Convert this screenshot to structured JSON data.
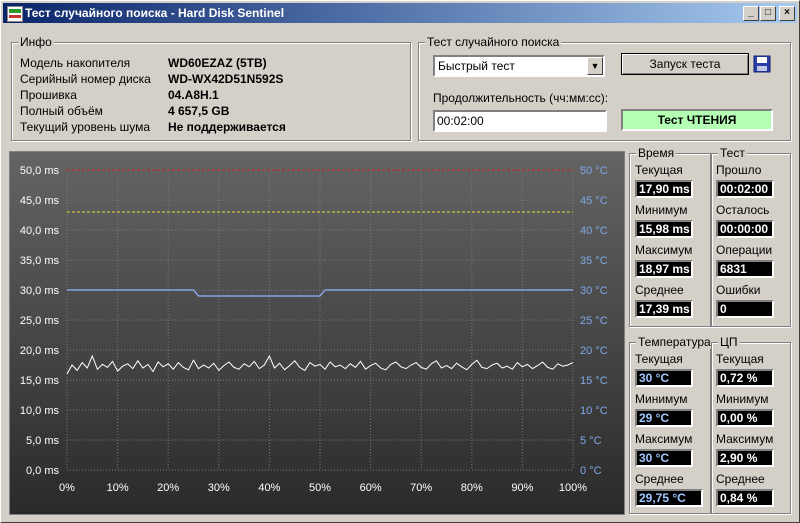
{
  "window": {
    "title": "Тест случайного поиска - Hard Disk Sentinel",
    "min": "_",
    "max": "□",
    "close": "×"
  },
  "info": {
    "title": "Инфо",
    "rows": [
      {
        "label": "Модель накопителя",
        "value": "WD60EZAZ (5TB)"
      },
      {
        "label": "Серийный номер диска",
        "value": "WD-WX42D51N592S"
      },
      {
        "label": "Прошивка",
        "value": "04.A8H.1"
      },
      {
        "label": "Полный объём",
        "value": "4 657,5 GB"
      },
      {
        "label": "Текущий уровень шума",
        "value": "Не поддерживается"
      }
    ]
  },
  "test": {
    "title": "Тест случайного поиска",
    "mode_selected": "Быстрый тест",
    "start_label": "Запуск теста",
    "duration_label": "Продолжительность (чч:мм:сс):",
    "duration_value": "00:02:00",
    "status": "Тест ЧТЕНИЯ"
  },
  "stats": {
    "time_title": "Время",
    "test_title": "Тест",
    "time": [
      {
        "label": "Текущая",
        "value": "17,90 ms"
      },
      {
        "label": "Минимум",
        "value": "15,98 ms"
      },
      {
        "label": "Максимум",
        "value": "18,97 ms"
      },
      {
        "label": "Среднее",
        "value": "17,39 ms"
      }
    ],
    "test": [
      {
        "label": "Прошло",
        "value": "00:02:00"
      },
      {
        "label": "Осталось",
        "value": "00:00:00"
      },
      {
        "label": "Операции",
        "value": "6831"
      },
      {
        "label": "Ошибки",
        "value": "0"
      }
    ],
    "temp_title": "Температура",
    "cpu_title": "ЦП",
    "temp": [
      {
        "label": "Текущая",
        "value": "30 °C"
      },
      {
        "label": "Минимум",
        "value": "29 °C"
      },
      {
        "label": "Максимум",
        "value": "30 °C"
      },
      {
        "label": "Среднее",
        "value": "29,75 °C"
      }
    ],
    "cpu": [
      {
        "label": "Текущая",
        "value": "0,72 %"
      },
      {
        "label": "Минимум",
        "value": "0,00 %"
      },
      {
        "label": "Максимум",
        "value": "2,90 %"
      },
      {
        "label": "Среднее",
        "value": "0,84 %"
      }
    ]
  },
  "chart_data": {
    "type": "line",
    "left_ticks": [
      "50,0 ms",
      "45,0 ms",
      "40,0 ms",
      "35,0 ms",
      "30,0 ms",
      "25,0 ms",
      "20,0 ms",
      "15,0 ms",
      "10,0 ms",
      "5,0 ms",
      "0,0 ms"
    ],
    "right_ticks": [
      "50 °C",
      "45 °C",
      "40 °C",
      "35 °C",
      "30 °C",
      "25 °C",
      "20 °C",
      "15 °C",
      "10 °C",
      "5 °C",
      "0 °C"
    ],
    "x_ticks": [
      "0%",
      "10%",
      "20%",
      "30%",
      "40%",
      "50%",
      "60%",
      "70%",
      "80%",
      "90%",
      "100%"
    ],
    "ylim": [
      0,
      50
    ],
    "xlim": [
      0,
      100
    ],
    "grid": true,
    "colors": {
      "seek": "#ffffff",
      "temperature": "#8fb4ff",
      "max_line": "#d02020",
      "avg_line": "#e0e040",
      "right_axis": "#7fa8e8",
      "left_axis": "#ffffff"
    },
    "reference_lines": [
      {
        "y": 50,
        "color": "#d02020"
      },
      {
        "y": 43,
        "color": "#e0e040"
      }
    ],
    "series": [
      {
        "x": [
          0,
          25,
          26,
          50,
          51,
          100
        ],
        "values": [
          30,
          30,
          29,
          29,
          30,
          30
        ]
      },
      {
        "x": [
          0,
          1,
          2,
          3,
          4,
          5,
          6,
          7,
          8,
          9,
          10,
          11,
          12,
          13,
          14,
          15,
          16,
          17,
          18,
          19,
          20,
          21,
          22,
          23,
          24,
          25,
          26,
          27,
          28,
          29,
          30,
          31,
          32,
          33,
          34,
          35,
          36,
          37,
          38,
          39,
          40,
          41,
          42,
          43,
          44,
          45,
          46,
          47,
          48,
          49,
          50,
          51,
          52,
          53,
          54,
          55,
          56,
          57,
          58,
          59,
          60,
          61,
          62,
          63,
          64,
          65,
          66,
          67,
          68,
          69,
          70,
          71,
          72,
          73,
          74,
          75,
          76,
          77,
          78,
          79,
          80,
          81,
          82,
          83,
          84,
          85,
          86,
          87,
          88,
          89,
          90,
          91,
          92,
          93,
          94,
          95,
          96,
          97,
          98,
          99,
          100
        ],
        "values": [
          16.0,
          17.5,
          16.6,
          17.9,
          17.0,
          19.0,
          16.8,
          17.6,
          17.1,
          18.1,
          16.5,
          17.3,
          17.7,
          16.9,
          18.2,
          17.0,
          17.6,
          16.4,
          18.0,
          17.2,
          17.7,
          16.8,
          17.9,
          17.1,
          16.7,
          18.3,
          16.9,
          17.5,
          17.0,
          17.8,
          16.6,
          17.4,
          18.0,
          17.1,
          16.8,
          17.7,
          17.2,
          18.1,
          16.9,
          17.5,
          19.0,
          17.0,
          17.8,
          16.7,
          17.4,
          18.2,
          17.1,
          16.6,
          17.9,
          17.3,
          17.6,
          16.8,
          18.0,
          17.2,
          17.5,
          16.9,
          17.7,
          17.1,
          18.1,
          16.8,
          17.4,
          17.8,
          17.0,
          16.7,
          17.6,
          18.0,
          17.2,
          16.9,
          17.5,
          17.9,
          17.1,
          16.8,
          17.7,
          18.2,
          17.0,
          17.4,
          16.9,
          17.8,
          17.2,
          16.7,
          17.6,
          18.3,
          17.1,
          16.9,
          17.5,
          17.8,
          17.0,
          17.3,
          16.8,
          17.9,
          17.2,
          17.6,
          16.9,
          17.4,
          18.0,
          17.1,
          16.8,
          17.7,
          17.3,
          17.5,
          17.9
        ]
      }
    ]
  }
}
